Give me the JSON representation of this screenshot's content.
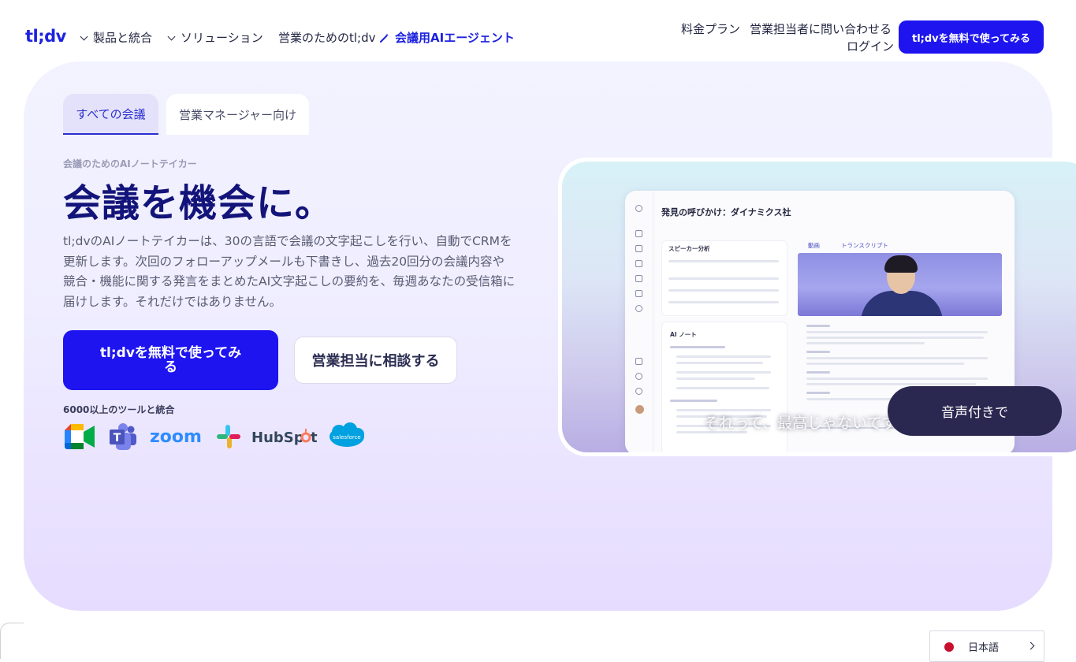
{
  "nav": {
    "logo": "tl;dv",
    "products": "製品と統合",
    "solutions": "ソリューション",
    "sales": "営業のためのtl;dv",
    "agent": "会議用AIエージェント",
    "pricing": "料金プラン",
    "contact": "営業担当者に問い合わせる",
    "login": "ログイン",
    "cta": "tl;dvを無料で使ってみる"
  },
  "tabs": [
    {
      "label": "すべての会議",
      "active": true
    },
    {
      "label": "営業マネージャー向け",
      "active": false
    }
  ],
  "hero": {
    "eyebrow": "会議のためのAIノートテイカー",
    "headline": "会議を機会に。",
    "description": "tl;dvのAIノートテイカーは、30の言語で会議の文字起こしを行い、自動でCRMを更新します。次回のフォローアップメールも下書きし、過去20回分の会議内容や競合・機能に関する発言をまとめたAI文字起こしの要約を、毎週あなたの受信箱に届けします。それだけではありません。",
    "primary_button": "tl;dvを無料で使ってみる",
    "secondary_button": "営業担当に相談する",
    "integrations_label": "6000以上のツールと統合",
    "integration_logos": [
      "google-meet",
      "microsoft-teams",
      "zoom",
      "slack",
      "hubspot",
      "salesforce"
    ]
  },
  "video": {
    "app_title": "発見の呼びかけ：ダイナミクス社",
    "speakers_title": "スピーカー分析",
    "ai_notes_title": "AI ノート",
    "tab_video": "動画",
    "tab_transcript": "トランスクリプト",
    "subtitle": "それって、最高じゃないですか。",
    "audio_pill": "音声付きで"
  },
  "language": {
    "label": "日本語"
  },
  "colors": {
    "brand": "#1d14f0",
    "headline": "#13147a"
  }
}
